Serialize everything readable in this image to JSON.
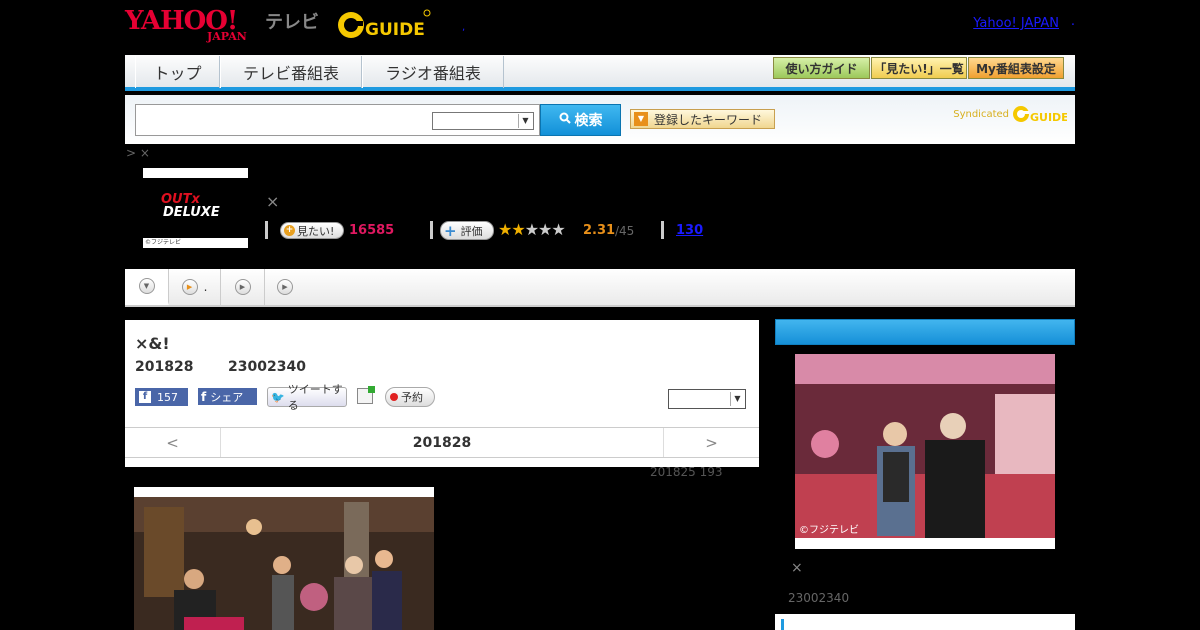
{
  "header": {
    "logo_text": "YAHOO!",
    "logo_sub": "JAPAN",
    "tv_label": "テレビ",
    "gguide_label": "GUIDE",
    "yahoo_link": "Yahoo! JAPAN",
    "small_dot": ",",
    "hdr_dot": "."
  },
  "nav": {
    "tabs": [
      {
        "label": "トップ"
      },
      {
        "label": "テレビ番組表"
      },
      {
        "label": "ラジオ番組表"
      }
    ],
    "buttons": [
      {
        "label": "使い方ガイド"
      },
      {
        "label": "「見たい!」一覧"
      },
      {
        "label": "My番組表設定"
      }
    ]
  },
  "search": {
    "value": "",
    "button_label": "検索",
    "keyword_button": "登録したキーワード",
    "syndicated": "Syndicated"
  },
  "program": {
    "breadcrumb": "> ×",
    "logo_line1": "OUTx",
    "logo_line2": "DELUXE",
    "credit": "©フジテレビ",
    "x_mark": "×",
    "want_label": "見たい!",
    "want_count": "16585",
    "rate_label": "評価",
    "rating": 2.31,
    "rating_text": "2.31",
    "rating_of": "/45",
    "review_count": "130"
  },
  "ep_tabs": {
    "second_label": "."
  },
  "main": {
    "title": "×&!",
    "date": "201828",
    "time": "23002340",
    "fb_like_count": "157",
    "fb_share_label": "シェア",
    "tweet_label": "ツイートする",
    "reserve_label": "予約",
    "pager_prev": "<",
    "pager_mid": "201828",
    "pager_next": ">",
    "meta": "201825  193"
  },
  "side": {
    "x_mark": "×",
    "time": "23002340",
    "credit": "©フジテレビ"
  },
  "colors": {
    "accent_blue": "#1e9ae0",
    "want_pink": "#e01860",
    "rating_orange": "#e8901a"
  }
}
